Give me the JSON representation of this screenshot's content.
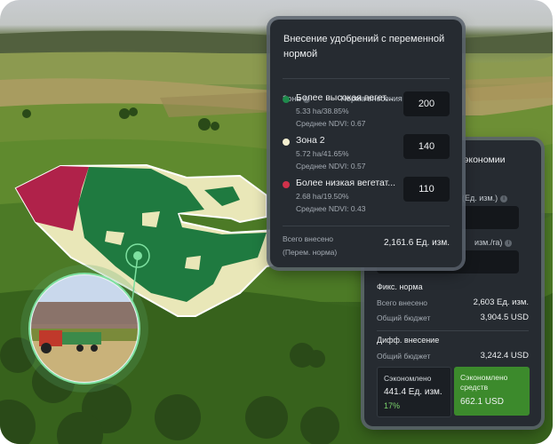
{
  "main_panel": {
    "title": "Внесение удобрений с переменной нормой",
    "col_zone": "Зона",
    "col_rate": "Норма внесения (Ед. изм./га)",
    "zones": [
      {
        "name": "Более высокая вегет...",
        "stats": "5.33 ha/38.85%",
        "ndvi": "Среднее NDVI: 0.67",
        "rate": "200",
        "color": "#1f8a4c"
      },
      {
        "name": "Зона 2",
        "stats": "5.72 ha/41.65%",
        "ndvi": "Среднее NDVI: 0.57",
        "rate": "140",
        "color": "#f3efd0"
      },
      {
        "name": "Более низкая вегетат...",
        "stats": "2.68 ha/19.50%",
        "ndvi": "Среднее NDVI: 0.43",
        "rate": "110",
        "color": "#d0324b"
      }
    ],
    "total_label": "Всего внесено (Перем. норма)",
    "total_value": "2,161.6 Ед. изм."
  },
  "back_panel": {
    "title_fragment": "экономии",
    "field1_label_fragment": "(Ед. изм.)",
    "field2_label_fragment": "изм./га)",
    "fixed_title": "Фикс. норма",
    "fixed_total_label": "Всего внесено",
    "fixed_total_value": "2,603 Ед. изм.",
    "fixed_budget_label": "Общий бюджет",
    "fixed_budget_value": "3,904.5 USD",
    "diff_title": "Дифф. внесение",
    "diff_budget_label": "Общий бюджет",
    "diff_budget_value": "3,242.4 USD",
    "saved_label": "Сэкономлено",
    "saved_value": "441.4 Ед. изм.",
    "saved_percent": "17%",
    "saved_money_label": "Сэкономлено средств",
    "saved_money_value": "662.1 USD"
  },
  "colors": {
    "panel_bg": "#262b31",
    "accent_green": "#3c8a2c",
    "percent_green": "#7bd36b",
    "zone_high": "#1f8a4c",
    "zone_mid": "#f3efd0",
    "zone_low": "#d0324b"
  }
}
